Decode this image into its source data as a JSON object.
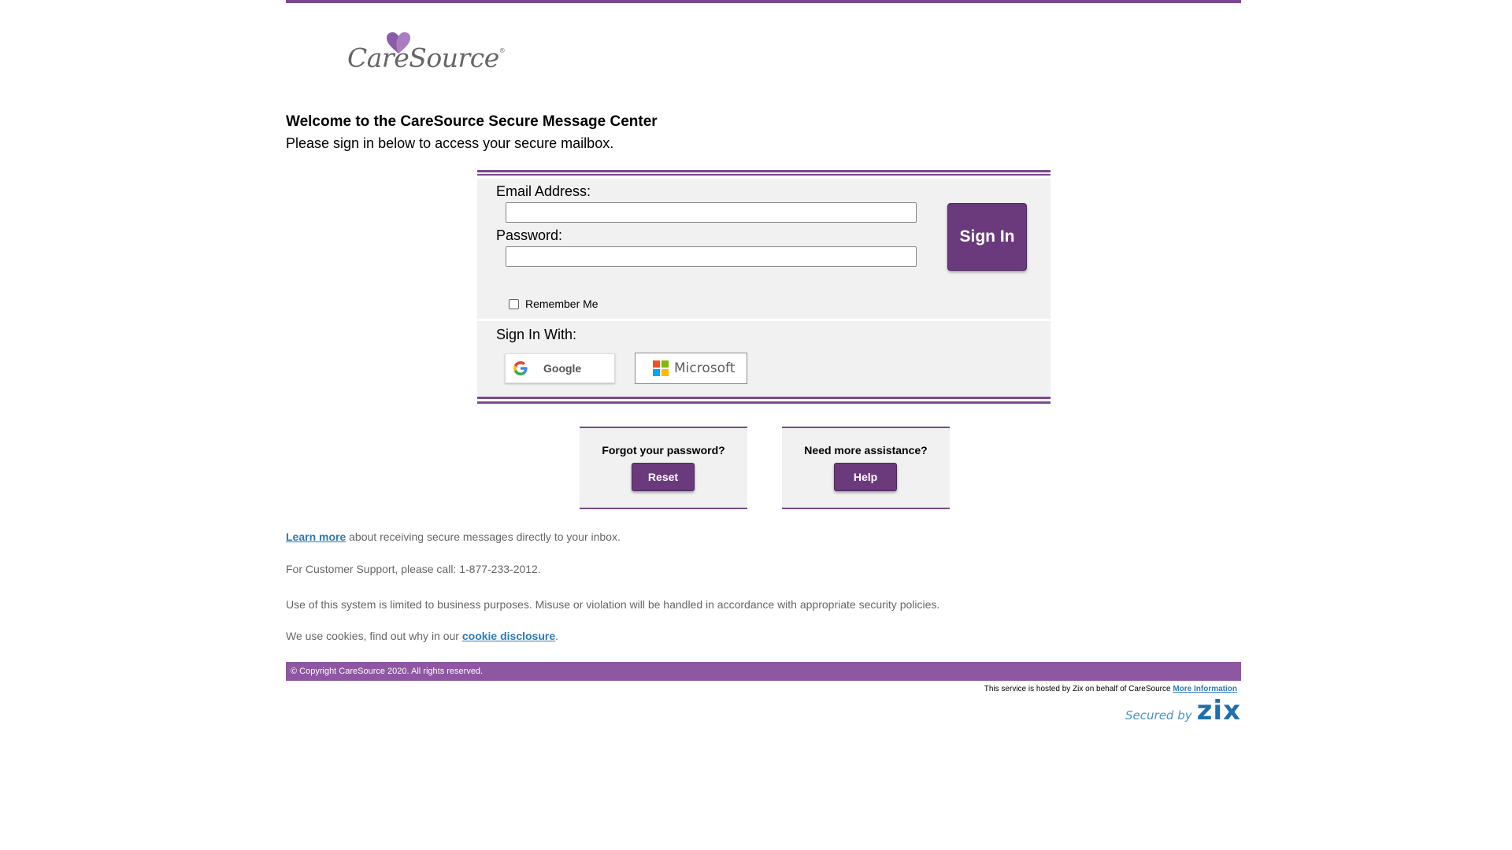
{
  "brand": {
    "name": "CareSource",
    "registered": "®",
    "primary_color": "#7b4a8e",
    "footer_color": "#8e57a1"
  },
  "header": {
    "title": "Welcome to the CareSource Secure Message Center",
    "subtitle": "Please sign in below to access your secure mailbox."
  },
  "login": {
    "email_label": "Email Address:",
    "email_value": "",
    "password_label": "Password:",
    "password_value": "",
    "sign_in_label": "Sign In",
    "remember_label": "Remember Me",
    "remember_checked": false,
    "sign_in_with_label": "Sign In With:",
    "google_label": "Google",
    "microsoft_label": "Microsoft"
  },
  "assist": {
    "forgot_question": "Forgot your password?",
    "reset_label": "Reset",
    "help_question": "Need more assistance?",
    "help_label": "Help"
  },
  "info": {
    "learn_more_link": "Learn more",
    "learn_more_text": " about receiving secure messages directly to your inbox.",
    "support_text": "For Customer Support, please call: 1-877-233-2012.",
    "usage_text": "Use of this system is limited to business purposes. Misuse or violation will be handled in accordance with appropriate security policies.",
    "cookie_prefix": "We use cookies, find out why in our ",
    "cookie_link": "cookie disclosure",
    "cookie_suffix": "."
  },
  "footer": {
    "copyright": "© Copyright CareSource 2020. All rights reserved.",
    "hosted_text": "This service is hosted by Zix on behalf of CareSource ",
    "more_info_link": "More Information",
    "secured_by": "Secured by",
    "zix": "zix"
  }
}
